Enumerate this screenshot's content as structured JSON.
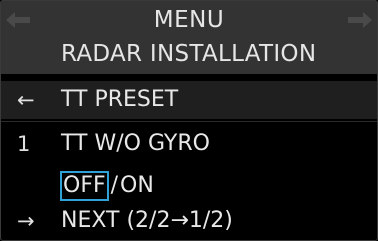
{
  "menu": {
    "title": "MENU",
    "subtitle": "RADAR INSTALLATION",
    "nav_left_icon": "arrow-left-icon",
    "nav_right_icon": "arrow-right-icon"
  },
  "rows": {
    "back": {
      "marker": "←",
      "label": "TT PRESET"
    },
    "item1": {
      "marker": "1",
      "label": "TT W/O GYRO"
    },
    "options": {
      "off": "OFF",
      "separator": "/",
      "on": "ON",
      "selected": "OFF"
    },
    "next": {
      "marker": "→",
      "label": "NEXT (2/2→1/2)"
    }
  },
  "colors": {
    "header_bg": "#333333",
    "background": "#000000",
    "selection_border": "#2fa3d8",
    "text": "#e8e8e8"
  }
}
